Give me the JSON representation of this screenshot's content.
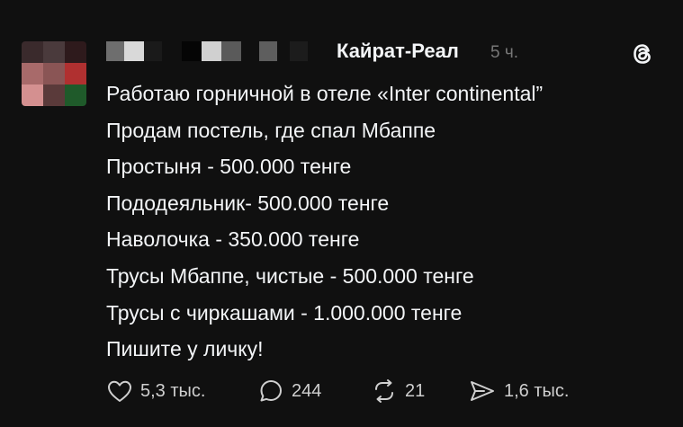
{
  "post": {
    "author": "Кайрат-Реал",
    "time": "5 ч.",
    "lines": [
      "Работаю горничной в отеле «Inter continental”",
      "Продам постель, где спал Мбаппе",
      "Простыня - 500.000 тенге",
      "Пододеяльник- 500.000 тенге",
      "Наволочка - 350.000 тенге",
      "Трусы Мбаппе, чистые - 500.000 тенге",
      "Трусы с чиркашами - 1.000.000 тенге",
      "Пишите у личку!"
    ]
  },
  "actions": {
    "likes": "5,3 тыс.",
    "replies": "244",
    "reposts": "21",
    "shares": "1,6 тыс."
  },
  "colors": {
    "background": "#101010",
    "text": "#f3f5f7",
    "muted": "#777777",
    "icon": "#cfcfcf"
  },
  "icons": [
    "threads-logo-icon",
    "heart-icon",
    "comment-icon",
    "repost-icon",
    "share-icon"
  ]
}
